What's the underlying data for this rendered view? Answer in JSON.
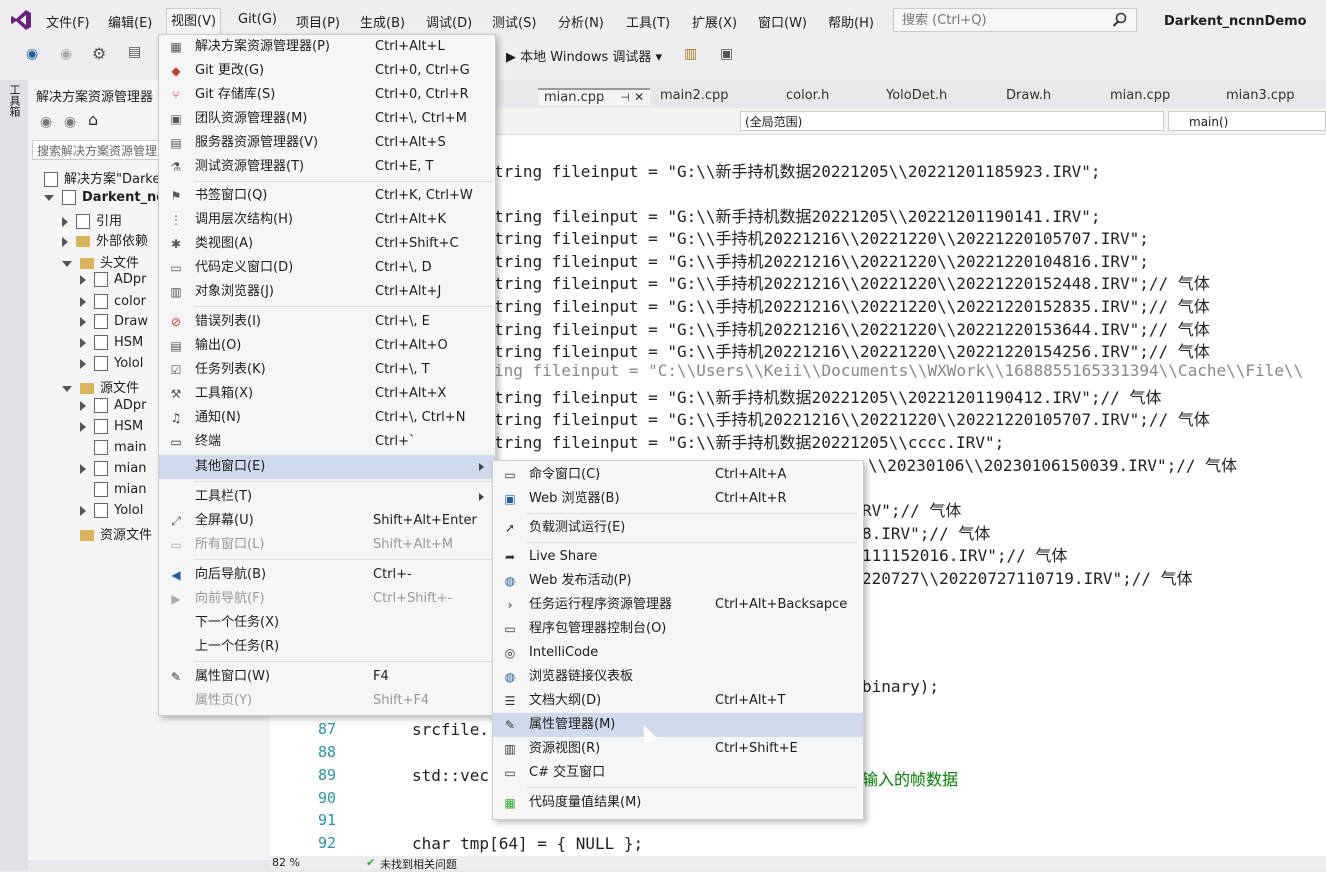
{
  "menubar": {
    "items": [
      "文件(F)",
      "编辑(E)",
      "视图(V)",
      "Git(G)",
      "项目(P)",
      "生成(B)",
      "调试(D)",
      "测试(S)",
      "分析(N)",
      "工具(T)",
      "扩展(X)",
      "窗口(W)",
      "帮助(H)"
    ],
    "search_placeholder": "搜索 (Ctrl+Q)",
    "solution_title": "Darkent_ncnnDemo"
  },
  "toolbar": {
    "run_label": "▶ 本地 Windows 调试器 ▾"
  },
  "left_strip": {
    "label": "工具箱"
  },
  "solution_explorer": {
    "title": "解决方案资源管理器",
    "search_placeholder": "搜索解决方案资源管理",
    "tree": [
      {
        "label": "解决方案\"Darke"
      },
      {
        "label": "Darkent_ne"
      },
      {
        "label": "引用"
      },
      {
        "label": "外部依赖"
      },
      {
        "label": "头文件"
      },
      {
        "label": "ADpr"
      },
      {
        "label": "color"
      },
      {
        "label": "Draw"
      },
      {
        "label": "HSM"
      },
      {
        "label": "Yolol"
      },
      {
        "label": "源文件"
      },
      {
        "label": "ADpr"
      },
      {
        "label": "HSM"
      },
      {
        "label": "main"
      },
      {
        "label": "mian"
      },
      {
        "label": "mian"
      },
      {
        "label": "Yolol"
      },
      {
        "label": "资源文件"
      }
    ]
  },
  "editor": {
    "tabs": [
      "mian.cpp",
      "main2.cpp",
      "color.h",
      "YoloDet.h",
      "Draw.h",
      "mian.cpp",
      "mian3.cpp"
    ],
    "tab_pin": "⊣",
    "tab_close": "✕",
    "scope": "(全局范围)",
    "function": "main()",
    "code_lines": [
      "tring fileinput = \"G:\\\\新手持机数据20221205\\\\20221201185923.IRV\";",
      "tring fileinput = \"G:\\\\新手持机数据20221205\\\\20221201190141.IRV\";",
      "tring fileinput = \"G:\\\\手持机20221216\\\\20221220\\\\20221220105707.IRV\";",
      "tring fileinput = \"G:\\\\手持机20221216\\\\20221220\\\\20221220104816.IRV\";",
      "tring fileinput = \"G:\\\\手持机20221216\\\\20221220\\\\20221220152448.IRV\";// 气体",
      "tring fileinput = \"G:\\\\手持机20221216\\\\20221220\\\\20221220152835.IRV\";// 气体",
      "tring fileinput = \"G:\\\\手持机20221216\\\\20221220\\\\20221220153644.IRV\";// 气体",
      "tring fileinput = \"G:\\\\手持机20221216\\\\20221220\\\\20221220154256.IRV\";// 气体",
      "ing fileinput = \"C:\\\\Users\\\\Keii\\\\Documents\\\\WXWork\\\\1688855165331394\\\\Cache\\\\File\\\\",
      "tring fileinput = \"G:\\\\新手持机数据20221205\\\\20221201190412.IRV\";// 气体",
      "tring fileinput = \"G:\\\\手持机20221216\\\\20221220\\\\20221220105707.IRV\";// 气体",
      "tring fileinput = \"G:\\\\新手持机数据20221205\\\\cccc.IRV\";",
      "\\\\20230106\\\\20230106150039.IRV\";// 气体",
      "RV\";// 气体",
      "8.IRV\";// 气体",
      "111152016.IRV\";// 气体",
      "220727\\\\20220727110719.IRV\";// 气体",
      "binary);",
      "srcfile.",
      "std::vec",
      "输入的帧数据",
      "char tmp[64] = { NULL };"
    ],
    "line_numbers": [
      "87",
      "88",
      "89",
      "90",
      "91",
      "92"
    ],
    "zoom": "82 %",
    "status": "未找到相关问题"
  },
  "view_menu": {
    "items": [
      {
        "label": "解决方案资源管理器(P)",
        "shortcut": "Ctrl+Alt+L"
      },
      {
        "label": "Git 更改(G)",
        "shortcut": "Ctrl+0, Ctrl+G"
      },
      {
        "label": "Git 存储库(S)",
        "shortcut": "Ctrl+0, Ctrl+R"
      },
      {
        "label": "团队资源管理器(M)",
        "shortcut": "Ctrl+\\, Ctrl+M"
      },
      {
        "label": "服务器资源管理器(V)",
        "shortcut": "Ctrl+Alt+S"
      },
      {
        "label": "测试资源管理器(T)",
        "shortcut": "Ctrl+E, T"
      },
      {
        "label": "书签窗口(Q)",
        "shortcut": "Ctrl+K, Ctrl+W"
      },
      {
        "label": "调用层次结构(H)",
        "shortcut": "Ctrl+Alt+K"
      },
      {
        "label": "类视图(A)",
        "shortcut": "Ctrl+Shift+C"
      },
      {
        "label": "代码定义窗口(D)",
        "shortcut": "Ctrl+\\, D"
      },
      {
        "label": "对象浏览器(J)",
        "shortcut": "Ctrl+Alt+J"
      },
      {
        "label": "错误列表(I)",
        "shortcut": "Ctrl+\\, E"
      },
      {
        "label": "输出(O)",
        "shortcut": "Ctrl+Alt+O"
      },
      {
        "label": "任务列表(K)",
        "shortcut": "Ctrl+\\, T"
      },
      {
        "label": "工具箱(X)",
        "shortcut": "Ctrl+Alt+X"
      },
      {
        "label": "通知(N)",
        "shortcut": "Ctrl+\\, Ctrl+N"
      },
      {
        "label": "终端",
        "shortcut": "Ctrl+`"
      },
      {
        "label": "其他窗口(E)",
        "shortcut": ""
      },
      {
        "label": "工具栏(T)",
        "shortcut": ""
      },
      {
        "label": "全屏幕(U)",
        "shortcut": "Shift+Alt+Enter"
      },
      {
        "label": "所有窗口(L)",
        "shortcut": "Shift+Alt+M"
      },
      {
        "label": "向后导航(B)",
        "shortcut": "Ctrl+-"
      },
      {
        "label": "向前导航(F)",
        "shortcut": "Ctrl+Shift+-"
      },
      {
        "label": "下一个任务(X)",
        "shortcut": ""
      },
      {
        "label": "上一个任务(R)",
        "shortcut": ""
      },
      {
        "label": "属性窗口(W)",
        "shortcut": "F4"
      },
      {
        "label": "属性页(Y)",
        "shortcut": "Shift+F4"
      }
    ]
  },
  "other_windows_menu": {
    "items": [
      {
        "label": "命令窗口(C)",
        "shortcut": "Ctrl+Alt+A"
      },
      {
        "label": "Web 浏览器(B)",
        "shortcut": "Ctrl+Alt+R"
      },
      {
        "label": "负载测试运行(E)",
        "shortcut": ""
      },
      {
        "label": "Live Share",
        "shortcut": ""
      },
      {
        "label": "Web 发布活动(P)",
        "shortcut": ""
      },
      {
        "label": "任务运行程序资源管理器",
        "shortcut": "Ctrl+Alt+Backsapce"
      },
      {
        "label": "程序包管理器控制台(O)",
        "shortcut": ""
      },
      {
        "label": "IntelliCode",
        "shortcut": ""
      },
      {
        "label": "浏览器链接仪表板",
        "shortcut": ""
      },
      {
        "label": "文档大纲(D)",
        "shortcut": "Ctrl+Alt+T"
      },
      {
        "label": "属性管理器(M)",
        "shortcut": ""
      },
      {
        "label": "资源视图(R)",
        "shortcut": "Ctrl+Shift+E"
      },
      {
        "label": "C# 交互窗口",
        "shortcut": ""
      },
      {
        "label": "代码度量值结果(M)",
        "shortcut": ""
      }
    ]
  },
  "colors": {
    "accent": "#68217a",
    "highlight": "#cfdbec",
    "string": "#a31515",
    "keyword": "#0000ff"
  }
}
